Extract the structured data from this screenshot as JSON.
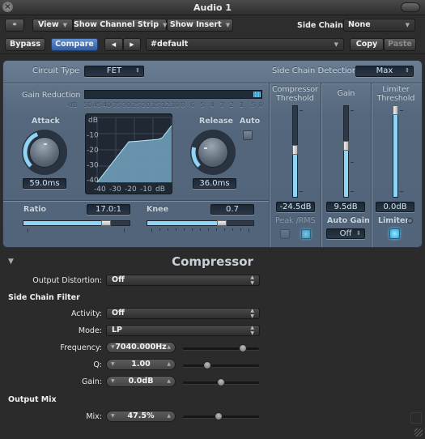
{
  "window": {
    "title": "Audio 1"
  },
  "toolbar": {
    "link_icon": "link-icon",
    "view_label": "View",
    "show_channel_strip_label": "Show Channel Strip",
    "show_insert_label": "Show Insert",
    "side_chain_label": "Side Chain:",
    "side_chain_value": "None",
    "bypass_label": "Bypass",
    "compare_label": "Compare",
    "prev_arrow": "◀",
    "next_arrow": "▶",
    "preset_value": "#default",
    "copy_label": "Copy",
    "paste_label": "Paste"
  },
  "plugin": {
    "circuit_type_label": "Circuit Type",
    "circuit_type_value": "FET",
    "side_chain_detection_label": "Side Chain Detection",
    "side_chain_detection_value": "Max",
    "gain_reduction_label": "Gain Reduction",
    "gain_reduction_level": 0.04,
    "gain_reduction_scale": [
      "-dB",
      "50",
      "45",
      "40",
      "35",
      "30",
      "25",
      "20",
      "15",
      "12",
      "10",
      "8",
      "6",
      "5",
      "4",
      "3",
      "2",
      "1",
      ".5",
      "0"
    ],
    "attack": {
      "label": "Attack",
      "value": "59.0ms",
      "position": 0.42
    },
    "release": {
      "label": "Release",
      "value": "36.0ms",
      "position": 0.22
    },
    "auto_label": "Auto",
    "auto_on": false,
    "graph": {
      "y_labels": [
        "dB",
        "-10",
        "-20",
        "-30",
        "-40"
      ],
      "x_labels": [
        "-40",
        "-30",
        "-20",
        "-10",
        "dB"
      ],
      "curve": [
        [
          -40,
          -40
        ],
        [
          -23,
          -15
        ],
        [
          -20,
          -14.8
        ],
        [
          -7,
          -13.5
        ],
        [
          -5,
          -12.5
        ],
        [
          0,
          -5
        ]
      ]
    },
    "ratio": {
      "label": "Ratio",
      "value": "17.0:1",
      "position": 0.78
    },
    "knee": {
      "label": "Knee",
      "value": "0.7",
      "position": 0.7
    },
    "compressor_threshold": {
      "label_line1": "Compressor",
      "label_line2": "Threshold",
      "value": "-24.5dB",
      "position": 0.52
    },
    "gain": {
      "label": "Gain",
      "value": "9.5dB",
      "position": 0.56
    },
    "limiter_threshold": {
      "label_line1": "Limiter",
      "label_line2": "Threshold",
      "value": "0.0dB",
      "position": 1.0
    },
    "peak_rms_label": "Peak /RMS",
    "auto_gain_label": "Auto Gain",
    "auto_gain_value": "Off",
    "limiter_label": "Limiter"
  },
  "extended": {
    "title": "Compressor",
    "output_distortion": {
      "label": "Output Distortion:",
      "value": "Off"
    },
    "side_chain_filter_header": "Side Chain Filter",
    "activity": {
      "label": "Activity:",
      "value": "Off"
    },
    "mode": {
      "label": "Mode:",
      "value": "LP"
    },
    "frequency": {
      "label": "Frequency:",
      "value": "7040.000Hz",
      "position": 0.82
    },
    "q": {
      "label": "Q:",
      "value": "1.00",
      "position": 0.3
    },
    "gain": {
      "label": "Gain:",
      "value": "0.0dB",
      "position": 0.5
    },
    "output_mix_header": "Output Mix",
    "mix": {
      "label": "Mix:",
      "value": "47.5%",
      "position": 0.47
    }
  },
  "colors": {
    "accent": "#8fd3f5",
    "panel": "#5b6d82",
    "background": "#2b2b2b",
    "compare_blue": "#3f6fb8"
  }
}
